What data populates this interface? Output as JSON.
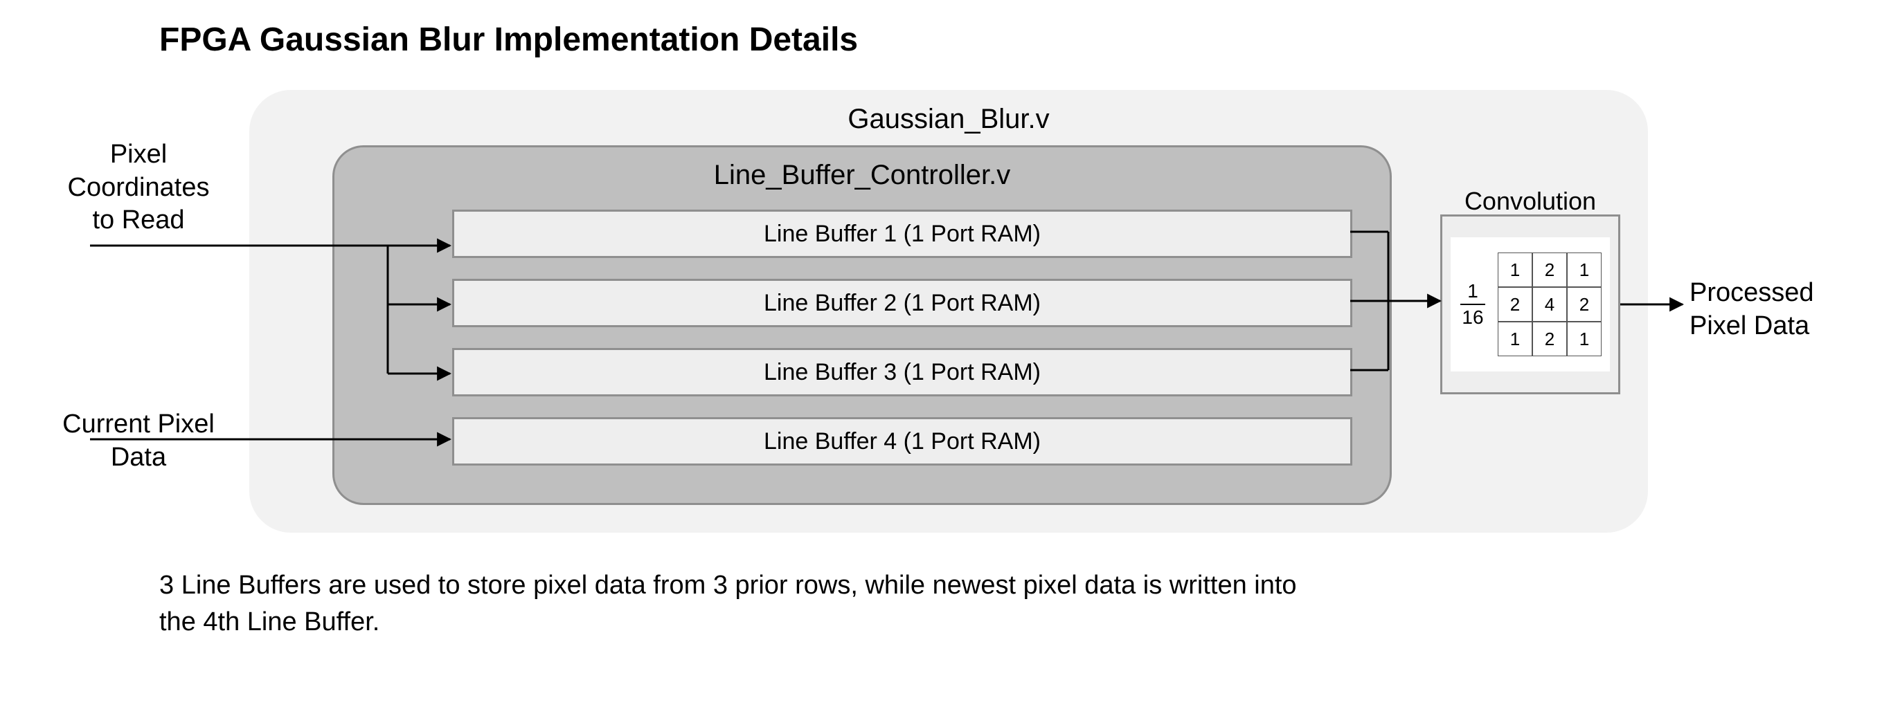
{
  "title": "FPGA Gaussian Blur Implementation Details",
  "outer_module": "Gaussian_Blur.v",
  "inner_module": "Line_Buffer_Controller.v",
  "line_buffers": [
    "Line Buffer 1 (1 Port RAM)",
    "Line Buffer 2 (1 Port RAM)",
    "Line Buffer 3 (1 Port RAM)",
    "Line Buffer 4 (1 Port RAM)"
  ],
  "conv_label": "Convolution",
  "kernel": {
    "scale_num": "1",
    "scale_den": "16",
    "values": [
      [
        "1",
        "2",
        "1"
      ],
      [
        "2",
        "4",
        "2"
      ],
      [
        "1",
        "2",
        "1"
      ]
    ]
  },
  "left_labels": {
    "coords_line1": "Pixel",
    "coords_line2": "Coordinates",
    "coords_line3": "to Read",
    "current_line1": "Current Pixel",
    "current_line2": "Data"
  },
  "right_labels": {
    "out_line1": "Processed",
    "out_line2": "Pixel Data"
  },
  "caption": "3 Line Buffers are used to store pixel data from 3 prior rows, while newest pixel data is written into the 4th Line Buffer."
}
